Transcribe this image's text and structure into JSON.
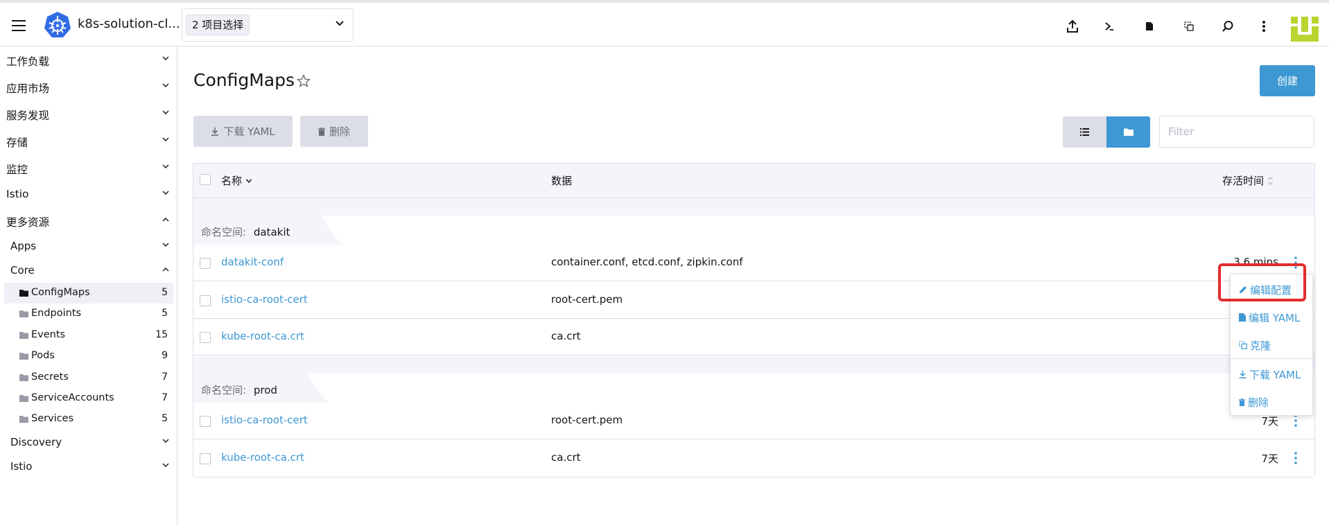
{
  "header": {
    "cluster_name": "k8s-solution-cl...",
    "namespace_selection": "2 项目选择"
  },
  "sidebar": {
    "groups": [
      {
        "label": "工作负载"
      },
      {
        "label": "应用市场"
      },
      {
        "label": "服务发现"
      },
      {
        "label": "存储"
      },
      {
        "label": "监控"
      },
      {
        "label": "Istio"
      },
      {
        "label": "更多资源"
      }
    ],
    "subgroups": [
      {
        "label": "Apps"
      },
      {
        "label": "Core"
      },
      {
        "label": "Discovery"
      },
      {
        "label": "Istio"
      }
    ],
    "core_items": [
      {
        "label": "ConfigMaps",
        "count": "5"
      },
      {
        "label": "Endpoints",
        "count": "5"
      },
      {
        "label": "Events",
        "count": "15"
      },
      {
        "label": "Pods",
        "count": "9"
      },
      {
        "label": "Secrets",
        "count": "7"
      },
      {
        "label": "ServiceAccounts",
        "count": "7"
      },
      {
        "label": "Services",
        "count": "5"
      }
    ]
  },
  "main": {
    "title": "ConfigMaps",
    "create_label": "创建",
    "download_yaml_label": "下载 YAML",
    "delete_label": "删除",
    "filter_placeholder": "Filter"
  },
  "table": {
    "columns": {
      "name": "名称",
      "data": "数据",
      "age": "存活时间"
    },
    "namespace_prefix": "命名空间:",
    "groups": [
      {
        "namespace": "datakit",
        "rows": [
          {
            "name": "datakit-conf",
            "data": "container.conf, etcd.conf, zipkin.conf",
            "age": "3.6 mins"
          },
          {
            "name": "istio-ca-root-cert",
            "data": "root-cert.pem",
            "age": ""
          },
          {
            "name": "kube-root-ca.crt",
            "data": "ca.crt",
            "age": ""
          }
        ]
      },
      {
        "namespace": "prod",
        "rows": [
          {
            "name": "istio-ca-root-cert",
            "data": "root-cert.pem",
            "age": "7天"
          },
          {
            "name": "kube-root-ca.crt",
            "data": "ca.crt",
            "age": "7天"
          }
        ]
      }
    ]
  },
  "context_menu": {
    "items": [
      {
        "label": "编辑配置",
        "icon": "pencil-icon"
      },
      {
        "label": "编辑 YAML",
        "icon": "file-icon"
      },
      {
        "label": "克隆",
        "icon": "copy-icon"
      },
      {
        "label": "下载 YAML",
        "icon": "download-icon"
      },
      {
        "label": "删除",
        "icon": "trash-icon"
      }
    ]
  },
  "colors": {
    "accent": "#3d98d3",
    "highlight": "#e52b2b",
    "gray_button": "#dcdee7"
  }
}
